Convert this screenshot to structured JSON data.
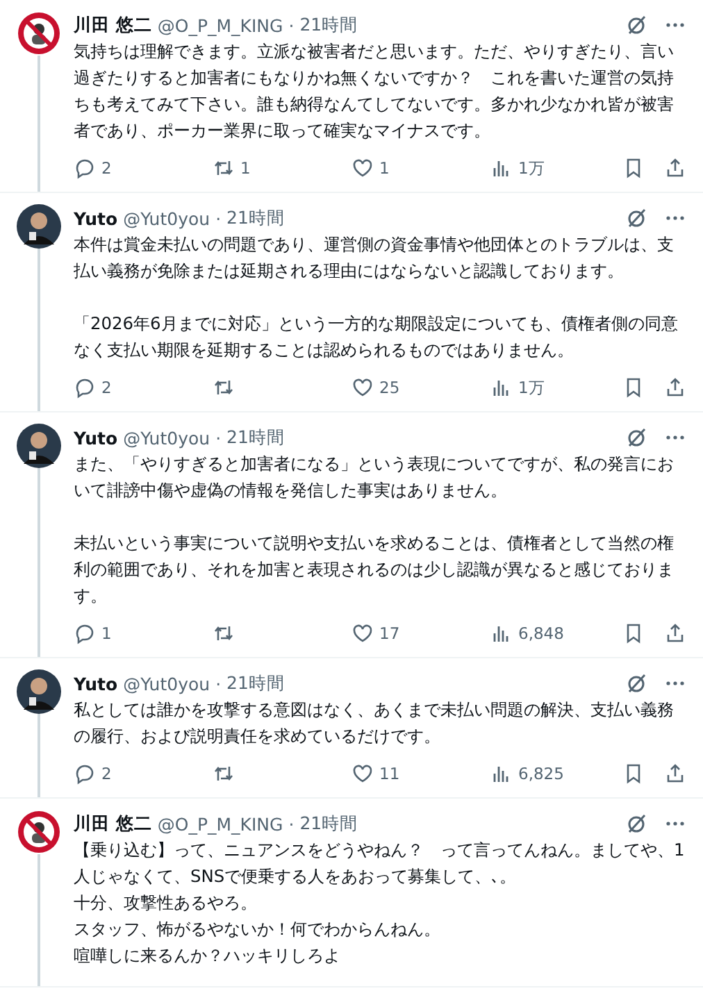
{
  "tweets": [
    {
      "kind": "logo",
      "name": "川田 悠二",
      "handle": "@O_P_M_KING",
      "separator": "·",
      "time": "21時間",
      "paragraphs": [
        [
          "気持ちは理解できます。立派な被害者だと思います。ただ、やりすぎたり、言い過ぎたりすると加害者にもなりかね無くないですか？　これを書いた運営の気持ちも考えてみて下さい。誰も納得なんてしてないです。多かれ少なかれ皆が被害者であり、ポーカー業界に取って確実なマイナスです。"
        ]
      ],
      "replies": "2",
      "retweets": "1",
      "likes": "1",
      "views": "1万"
    },
    {
      "kind": "person",
      "name": "Yuto",
      "handle": "@Yut0you",
      "separator": "·",
      "time": "21時間",
      "paragraphs": [
        [
          "本件は賞金未払いの問題であり、運営側の資金事情や他団体とのトラブルは、支払い義務が免除または延期される理由にはならないと認識しております。"
        ],
        [
          "「2026年6月までに対応」という一方的な期限設定についても、債権者側の同意なく支払い期限を延期することは認められるものではありません。"
        ]
      ],
      "replies": "2",
      "likes": "25",
      "views": "1万"
    },
    {
      "kind": "person",
      "name": "Yuto",
      "handle": "@Yut0you",
      "separator": "·",
      "time": "21時間",
      "paragraphs": [
        [
          "また、「やりすぎると加害者になる」という表現についてですが、私の発言において誹謗中傷や虚偽の情報を発信した事実はありません。"
        ],
        [
          "未払いという事実について説明や支払いを求めることは、債権者として当然の権利の範囲であり、それを加害と表現されるのは少し認識が異なると感じております。"
        ]
      ],
      "replies": "1",
      "likes": "17",
      "views": "6,848"
    },
    {
      "kind": "person",
      "name": "Yuto",
      "handle": "@Yut0you",
      "separator": "·",
      "time": "21時間",
      "paragraphs": [
        [
          "私としては誰かを攻撃する意図はなく、あくまで未払い問題の解決、支払い義務の履行、および説明責任を求めているだけです。"
        ]
      ],
      "replies": "2",
      "likes": "11",
      "views": "6,825"
    },
    {
      "kind": "logo",
      "name": "川田 悠二",
      "handle": "@O_P_M_KING",
      "separator": "·",
      "time": "21時間",
      "paragraphs": [
        [
          "【乗り込む】って、ニュアンスをどうやねん？　って言ってんねん。ましてや、1人じゃなくて、SNSで便乗する人をあおって募集して、､。",
          "十分、攻撃性あるやろ。",
          "スタッフ、怖がるやないか！何でわからんねん。",
          "喧嘩しに来るんか？ハッキリしろよ"
        ]
      ]
    }
  ]
}
